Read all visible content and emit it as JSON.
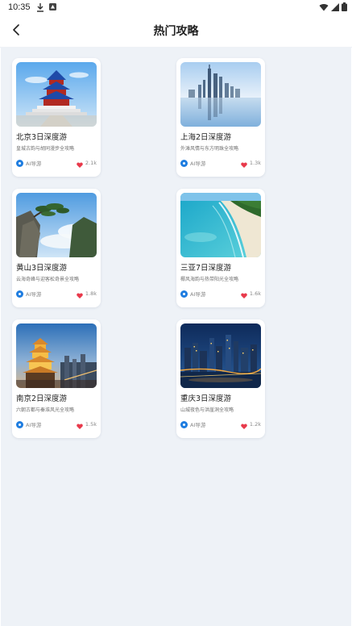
{
  "status_bar": {
    "time": "10:35"
  },
  "header": {
    "title": "热门攻略"
  },
  "colors": {
    "accent": "#1f7de0",
    "heart": "#e8394b",
    "background": "#eef2f7"
  },
  "cards": [
    {
      "title": "北京3日深度游",
      "desc": "皇城古韵与胡同漫步全攻略",
      "author": "AI导游",
      "likes": "2.1k",
      "image": "temple-of-heaven"
    },
    {
      "title": "上海2日深度游",
      "desc": "外滩风情与东方明珠全攻略",
      "author": "AI导游",
      "likes": "1.3k",
      "image": "shanghai-skyline"
    },
    {
      "title": "黄山3日深度游",
      "desc": "云海奇峰与迎客松奇景全攻略",
      "author": "AI导游",
      "likes": "1.8k",
      "image": "huangshan-pine"
    },
    {
      "title": "三亚7日深度游",
      "desc": "椰风海韵与热带阳光全攻略",
      "author": "AI导游",
      "likes": "1.6k",
      "image": "sanya-beach"
    },
    {
      "title": "南京2日深度游",
      "desc": "六朝古都与秦淮风光全攻略",
      "author": "AI导游",
      "likes": "1.5k",
      "image": "yellow-crane-tower"
    },
    {
      "title": "重庆3日深度游",
      "desc": "山城夜色与洪崖洞全攻略",
      "author": "AI导游",
      "likes": "1.2k",
      "image": "chongqing-night"
    }
  ]
}
